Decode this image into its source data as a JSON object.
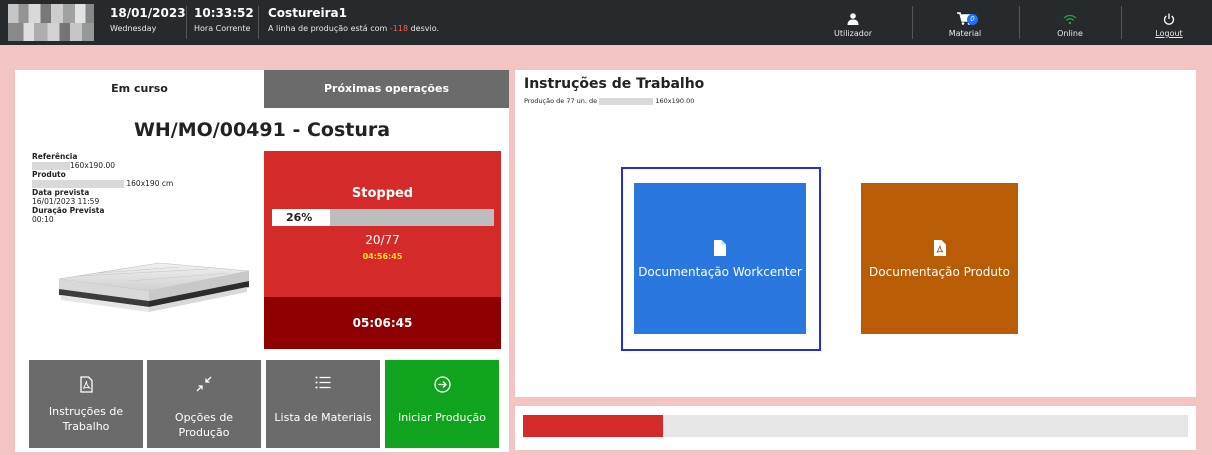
{
  "header": {
    "date": "18/01/2023",
    "weekday": "Wednesday",
    "time": "10:33:52",
    "time_label": "Hora Corrente",
    "workcenter": "Costureira1",
    "line_status_prefix": "A linha de produção está com ",
    "line_status_value": "-118",
    "line_status_suffix": " desvio.",
    "user_label": "Utilizador",
    "material_label": "Material",
    "material_count": "0",
    "online_label": "Online",
    "logout_label": "Logout"
  },
  "tabs": {
    "current": "Em curso",
    "next": "Próximas operações"
  },
  "order": {
    "title": "WH/MO/00491 - Costura",
    "reference_label": "Referência",
    "reference_value": "160x190.00",
    "product_label": "Produto",
    "product_value": "160x190 cm",
    "due_label": "Data prevista",
    "due_value": "16/01/2023 11:59",
    "duration_label": "Duração Prevista",
    "duration_value": "00:10"
  },
  "status": {
    "state": "Stopped",
    "progress_label": "26%",
    "progress": 0.26,
    "quantity": "20/77",
    "elapsed": "04:56:45",
    "timer": "05:06:45"
  },
  "actions": {
    "instructions": "Instruções de Trabalho",
    "options": "Opções de Produção",
    "materials": "Lista de Materiais",
    "start": "Iniciar Produção"
  },
  "instructions_panel": {
    "title": "Instruções de Trabalho",
    "subtitle_prefix": "Produção de 77 un. de",
    "subtitle_value": "160x190.00",
    "doc_workcenter": "Documentação Workcenter",
    "doc_product": "Documentação Produto"
  },
  "bottom_progress": {
    "fraction": 0.21
  },
  "colors": {
    "background": "#f2c4c4",
    "topbar": "#272a2d",
    "status_red": "#d42a2a",
    "timer_dark_red": "#8e0000",
    "button_grey": "#6b6b6b",
    "start_green": "#10a41e",
    "doc_blue": "#2a77e0",
    "doc_orange": "#b85c05",
    "elapsed_yellow": "#ffe31a"
  },
  "icons": {
    "user": "user-icon",
    "cart": "cart-icon",
    "wifi": "wifi-icon",
    "power": "power-icon",
    "pdf": "pdf-icon",
    "collapse": "collapse-icon",
    "list": "list-icon",
    "arrow": "arrow-circle-right-icon",
    "file": "file-icon"
  }
}
